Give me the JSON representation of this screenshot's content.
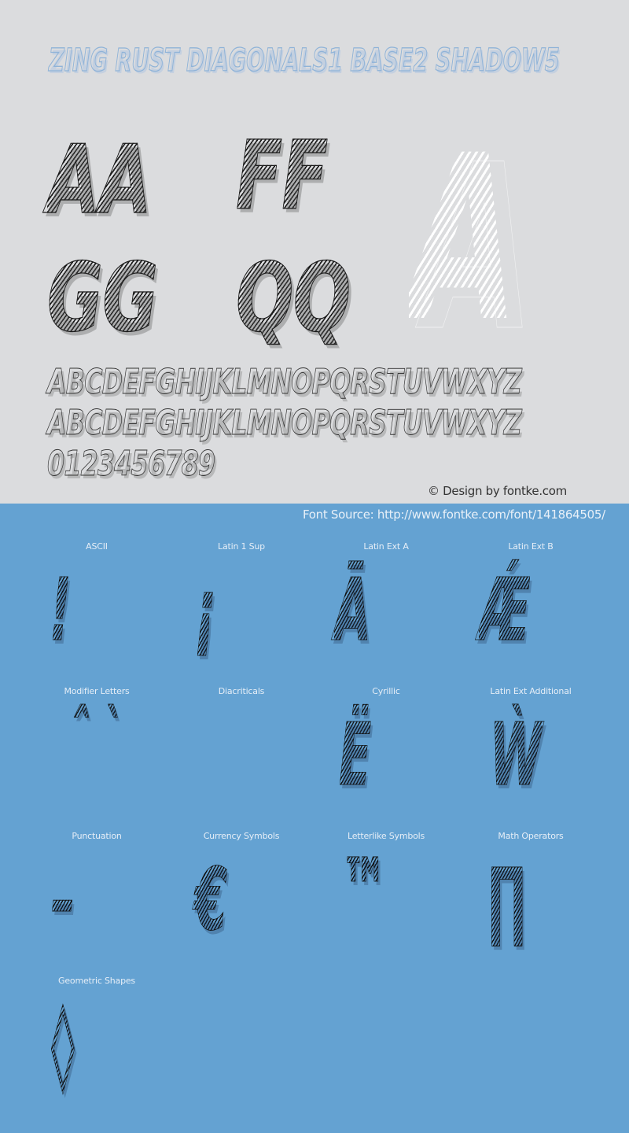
{
  "header": {
    "title": "ZING RUST DIAGONALS1 BASE2 SHADOW5"
  },
  "preview": {
    "pairs": [
      "AA",
      "FF",
      "GG",
      "QQ"
    ],
    "hero_glyph": "A",
    "uppercase": "ABCDEFGHIJKLMNOPQRSTUVWXYZ",
    "lowercase": "ABCDEFGHIJKLMNOPQRSTUVWXYZ",
    "digits": "0123456789"
  },
  "footer": {
    "credit": "© Design by fontke.com",
    "source": "Font Source: http://www.fontke.com/font/141864505/"
  },
  "colors": {
    "top_background": "#dbdcde",
    "bottom_background": "#64a2d2",
    "title_outline": "#8fb3d8",
    "glyph_ink": "#1a1a1a",
    "hero_ink": "#ffffff"
  },
  "charsets": [
    {
      "label": "ASCII",
      "glyph": "!"
    },
    {
      "label": "Latin 1 Sup",
      "glyph": "¡"
    },
    {
      "label": "Latin Ext A",
      "glyph": "Ā"
    },
    {
      "label": "Latin Ext B",
      "glyph": "Ǽ"
    },
    {
      "label": "Modifier Letters",
      "glyph": "ˆ  ˋ"
    },
    {
      "label": "Diacriticals",
      "glyph": ""
    },
    {
      "label": "Cyrillic",
      "glyph": "Ë"
    },
    {
      "label": "Latin Ext Additional",
      "glyph": "Ẁ"
    },
    {
      "label": "Punctuation",
      "glyph": "–"
    },
    {
      "label": "Currency Symbols",
      "glyph": "€"
    },
    {
      "label": "Letterlike Symbols",
      "glyph": "™"
    },
    {
      "label": "Math Operators",
      "glyph": "∏"
    },
    {
      "label": "Geometric Shapes",
      "glyph": "◊"
    }
  ]
}
